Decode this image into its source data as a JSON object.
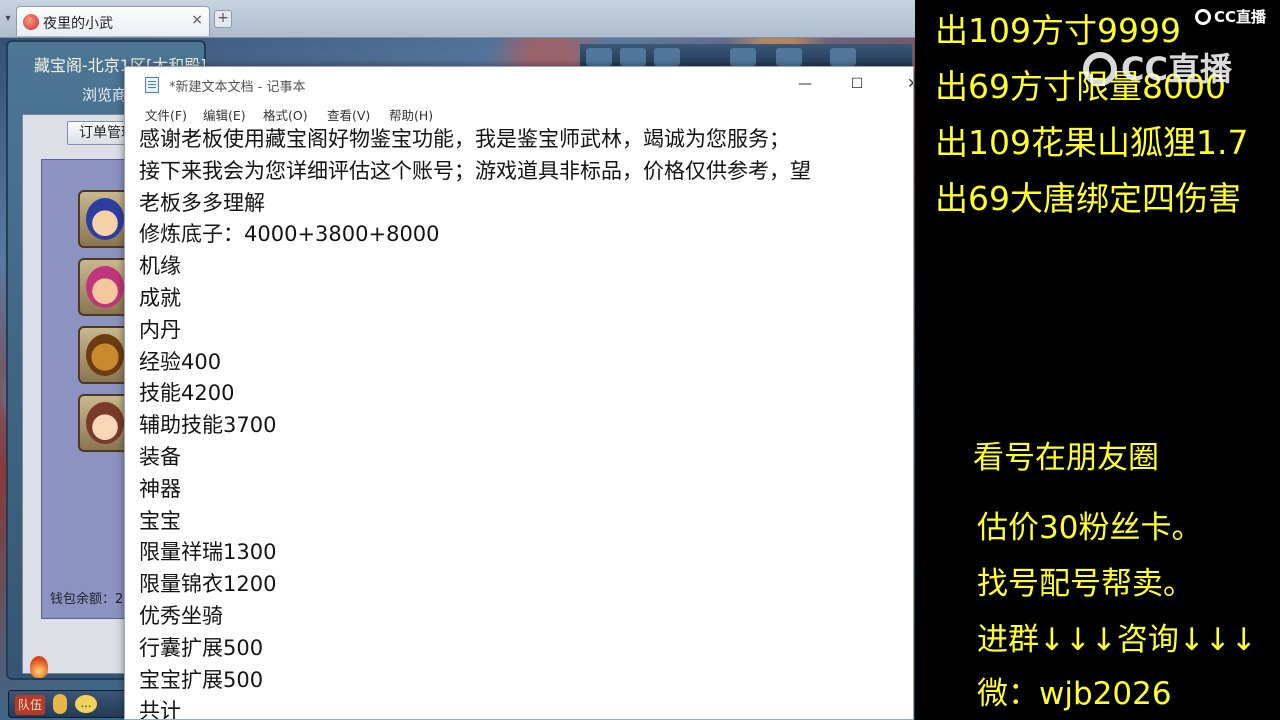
{
  "browser": {
    "tab_title": "夜里的小武",
    "tab_close": "×",
    "new_tab": "+",
    "tab_arrow": "▾"
  },
  "game": {
    "panel_title": "藏宝阁-北京1区[太和殿]",
    "browse_tab": "浏览商",
    "order_button": "订单管理",
    "wallet_label": "钱包余额：2",
    "team_button": "队伍",
    "chat_glyph": "…"
  },
  "notepad": {
    "title": "*新建文本文档 - 记事本",
    "min_glyph": "—",
    "max_glyph": "☐",
    "close_glyph": "✕",
    "menus": [
      "文件(F)",
      "编辑(E)",
      "格式(O)",
      "查看(V)",
      "帮助(H)"
    ],
    "lines": [
      "感谢老板使用藏宝阁好物鉴宝功能，我是鉴宝师武林，竭诚为您服务；",
      "接下来我会为您详细评估这个账号；游戏道具非标品，价格仅供参考，望",
      "老板多多理解",
      "修炼底子：4000+3800+8000",
      "机缘",
      "成就",
      "内丹",
      "经验400",
      "技能4200",
      "辅助技能3700",
      "装备",
      "神器",
      "宝宝",
      "限量祥瑞1300",
      "限量锦衣1200",
      "优秀坐骑",
      "行囊扩展500",
      "宝宝扩展500",
      "共计"
    ]
  },
  "overlay": {
    "sales": [
      "出109方寸9999",
      "出69方寸限量8000",
      "出109花果山狐狸1.7",
      "出69大唐绑定四伤害"
    ],
    "logo_small": "CC直播",
    "logo_watermark": "CC直播",
    "info": [
      "看号在朋友圈",
      "估价30粉丝卡。",
      "找号配号帮卖。",
      "进群↓↓↓咨询↓↓↓",
      "微：wjb2026"
    ],
    "accent_color": "#ffff2a"
  }
}
